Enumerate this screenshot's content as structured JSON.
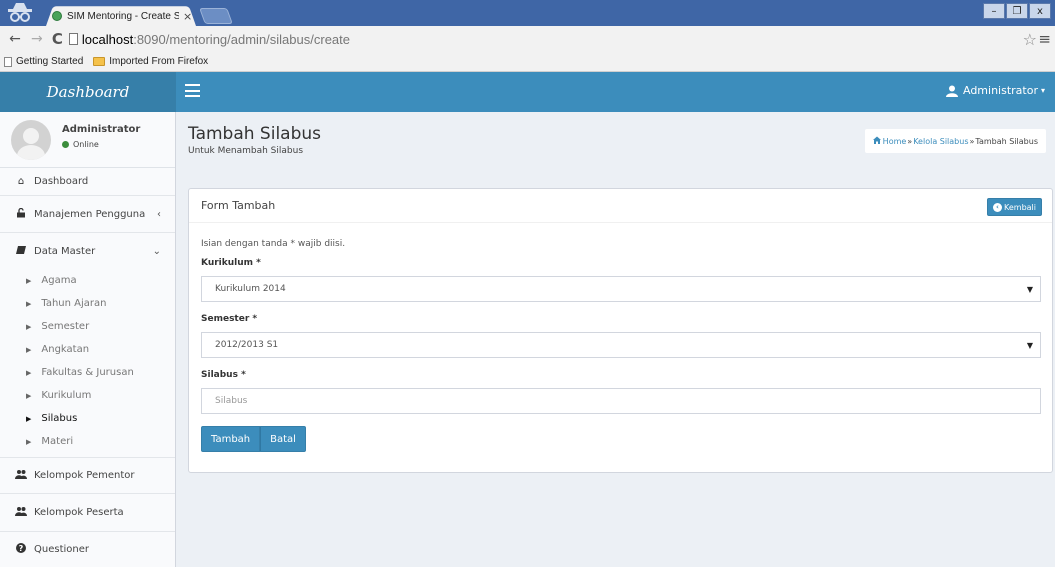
{
  "browser": {
    "tab_title": "SIM Mentoring - Create Silab",
    "tab_close": "×",
    "url_host": "localhost",
    "url_rest": ":8090/mentoring/admin/silabus/create",
    "window_controls": [
      "–",
      "❐",
      "x"
    ],
    "bookmarks": [
      {
        "label": "Getting Started",
        "icon": "page-icon"
      },
      {
        "label": "Imported From Firefox",
        "icon": "folder-icon"
      }
    ]
  },
  "header": {
    "logo": "Dashboard",
    "user": "Administrator",
    "caret": "▾"
  },
  "sidebar": {
    "user_name": "Administrator",
    "user_status": "Online",
    "items": [
      {
        "label": "Dashboard",
        "icon": "home-icon",
        "glyph": "⌂"
      },
      {
        "label": "Manajemen Pengguna",
        "icon": "unlock-icon",
        "glyph": "🔓",
        "caret": "‹"
      },
      {
        "label": "Data Master",
        "icon": "book-icon",
        "glyph": "▰",
        "caret": "⌄"
      }
    ],
    "submenu": [
      {
        "label": "Agama",
        "active": false
      },
      {
        "label": "Tahun Ajaran",
        "active": false
      },
      {
        "label": "Semester",
        "active": false
      },
      {
        "label": "Angkatan",
        "active": false
      },
      {
        "label": "Fakultas & Jurusan",
        "active": false
      },
      {
        "label": "Kurikulum",
        "active": false
      },
      {
        "label": "Silabus",
        "active": true
      },
      {
        "label": "Materi",
        "active": false
      }
    ],
    "bottom_items": [
      {
        "label": "Kelompok Pementor",
        "icon": "users-icon",
        "glyph": "👥"
      },
      {
        "label": "Kelompok Peserta",
        "icon": "users-icon",
        "glyph": "👥"
      },
      {
        "label": "Questioner",
        "icon": "question-icon",
        "glyph": "?"
      }
    ]
  },
  "content": {
    "title": "Tambah Silabus",
    "subtitle": "Untuk Menambah Silabus",
    "breadcrumb": {
      "home": "Home",
      "sep": "»",
      "section": "Kelola Silabus",
      "current": "Tambah Silabus"
    }
  },
  "form": {
    "box_title": "Form Tambah",
    "back_button": "Kembali",
    "note": "Isian dengan tanda * wajib diisi.",
    "kurikulum_label": "Kurikulum *",
    "kurikulum_value": "Kurikulum 2014",
    "semester_label": "Semester *",
    "semester_value": "2012/2013 S1",
    "silabus_label": "Silabus *",
    "silabus_placeholder": "Silabus",
    "submit_button": "Tambah",
    "cancel_button": "Batal"
  },
  "colors": {
    "navbar": "#3c8dbc",
    "logo_bg": "#367fa9",
    "tabstrip": "#3f66a6",
    "content_bg": "#ecf0f5",
    "sidebar_bg": "#f9fafc",
    "online": "#3c8d3c"
  }
}
